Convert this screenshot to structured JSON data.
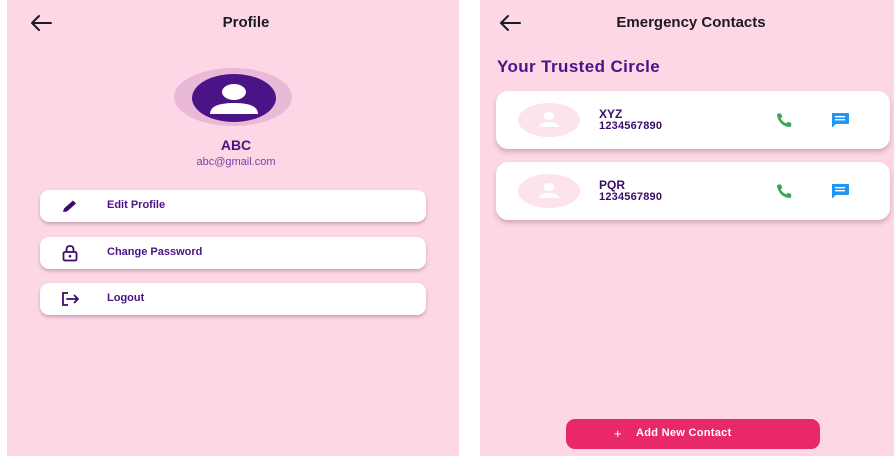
{
  "profile_screen": {
    "title": "Profile",
    "user": {
      "name": "ABC",
      "email": "abc@gmail.com"
    },
    "menu": [
      {
        "label": "Edit Profile",
        "icon": "pencil-icon"
      },
      {
        "label": "Change Password",
        "icon": "lock-icon"
      },
      {
        "label": "Logout",
        "icon": "logout-icon"
      }
    ]
  },
  "contacts_screen": {
    "title": "Emergency Contacts",
    "heading": "Your Trusted Circle",
    "contacts": [
      {
        "name": "XYZ",
        "phone": "1234567890"
      },
      {
        "name": "PQR",
        "phone": "1234567890"
      }
    ],
    "add_button": {
      "label": "Add New Contact",
      "icon": "plus"
    }
  },
  "colors": {
    "background": "#fdd7e5",
    "primary_purple": "#4a1486",
    "accent_pink": "#e9276b",
    "call_green": "#34a853",
    "message_blue": "#2196f3"
  }
}
